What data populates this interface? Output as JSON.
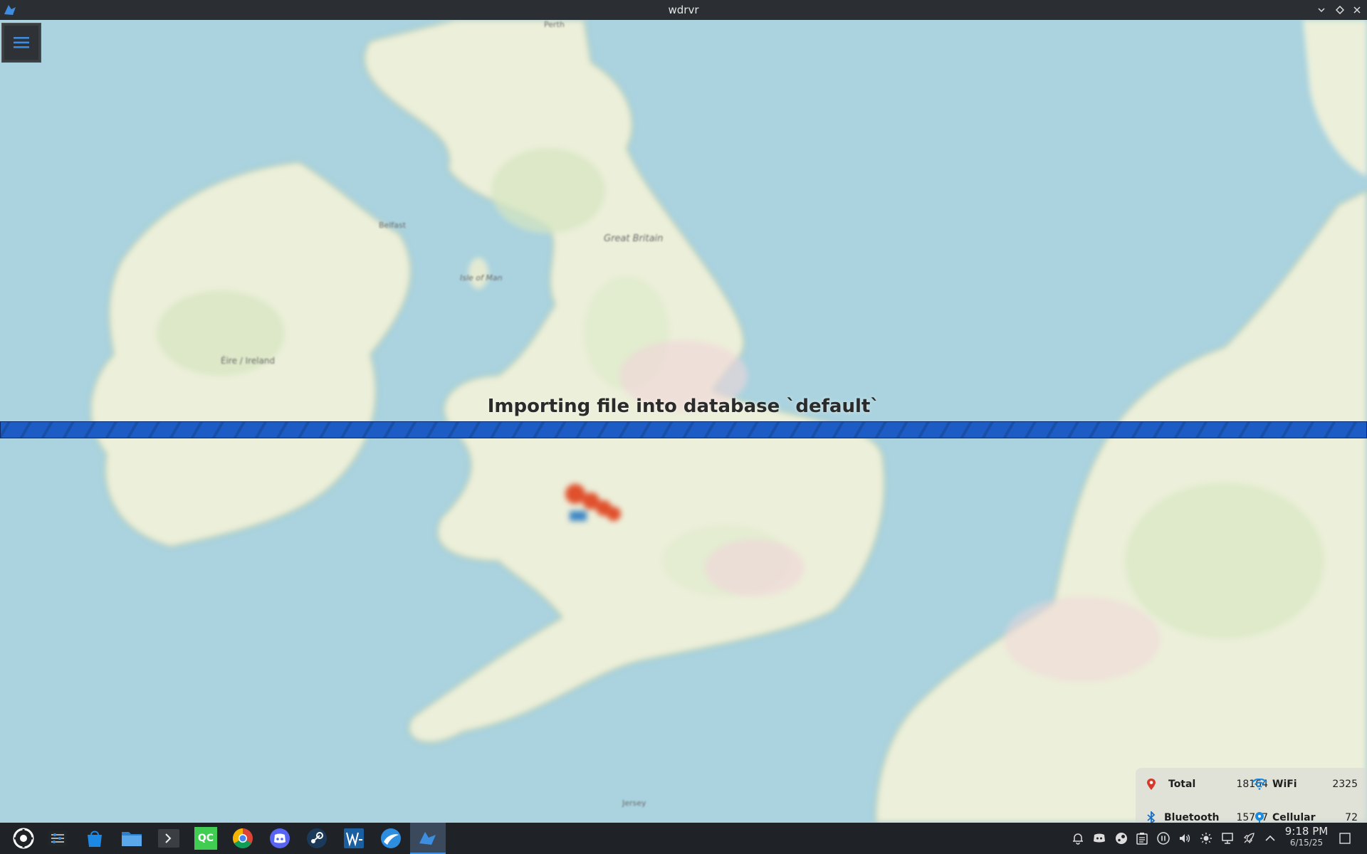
{
  "window": {
    "title": "wdrvr"
  },
  "map": {
    "labels": {
      "great_britain": "Great Britain",
      "isle_of_man": "Isle of Man",
      "eire_ireland": "Éire / Ireland",
      "belfast": "Belfast",
      "perth": "Perth",
      "jersey": "Jersey"
    }
  },
  "import_overlay": {
    "title": "Importing file into database `default`",
    "progress": 1.0
  },
  "stats": {
    "total_label": "Total",
    "total_value": "18164",
    "wifi_label": "WiFi",
    "wifi_value": "2325",
    "bluetooth_label": "Bluetooth",
    "bluetooth_value": "15767",
    "cellular_label": "Cellular",
    "cellular_value": "72"
  },
  "taskbar": {
    "apps": [
      "application-launcher-icon",
      "system-settings-icon",
      "discover-store-icon",
      "file-manager-icon",
      "konsole-icon",
      "qt-creator-icon",
      "chrome-icon",
      "discord-icon",
      "steam-icon",
      "wireshark-icon",
      "browser-icon",
      "wdrvr-icon"
    ],
    "qt_label": "QC",
    "clock_time": "9:18 PM",
    "clock_date": "6/15/25"
  }
}
